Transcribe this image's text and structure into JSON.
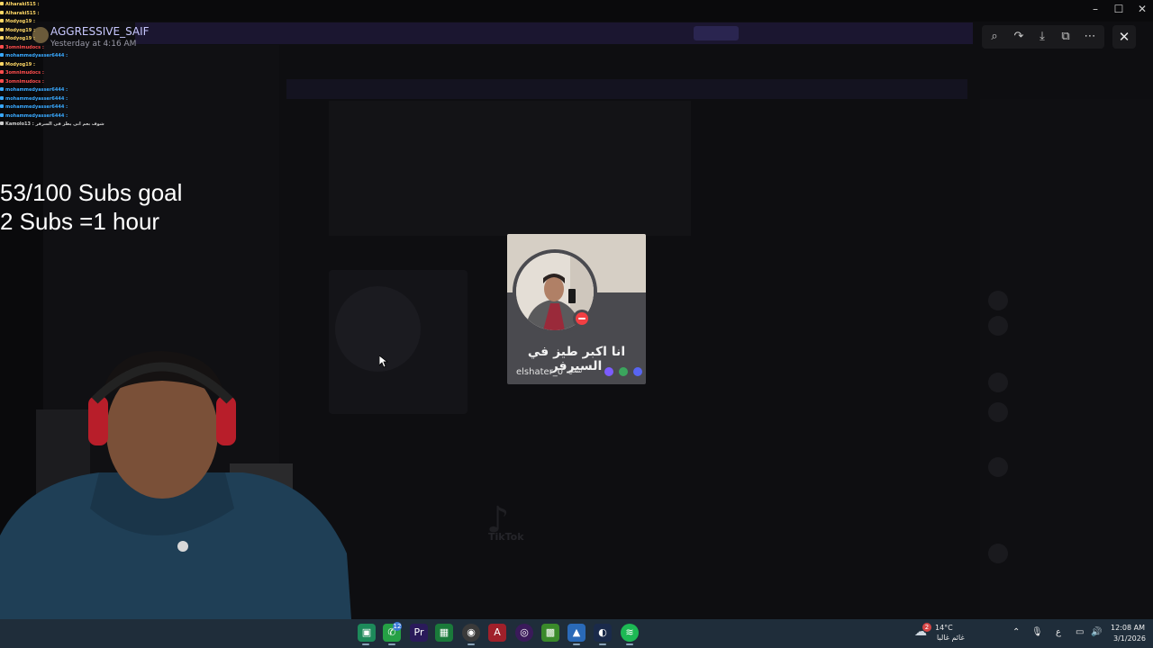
{
  "stream_overlay": {
    "goal_line1": "53/100 Subs goal",
    "goal_line2": "2 Subs =1 hour",
    "chat": [
      {
        "user": "Alharaki515 :",
        "color": "#ffd866"
      },
      {
        "user": "Alharaki515 :",
        "color": "#ffd866"
      },
      {
        "user": "Modyog19 :",
        "color": "#ffd866"
      },
      {
        "user": "Modyog19 :",
        "color": "#ffd866"
      },
      {
        "user": "Modyog19 :",
        "color": "#ffd866"
      },
      {
        "user": "3omnimudocs :",
        "color": "#ff4d4d"
      },
      {
        "user": "mohammedyasser6444 :",
        "color": "#39a9ff"
      },
      {
        "user": "Modyog19 :",
        "color": "#ffd866"
      },
      {
        "user": "3omnimudocs :",
        "color": "#ff4d4d"
      },
      {
        "user": "3omnimudocs :",
        "color": "#ff4d4d"
      },
      {
        "user": "mohammedyasser6444 :",
        "color": "#39a9ff"
      },
      {
        "user": "mohammedyasser6444 :",
        "color": "#39a9ff"
      },
      {
        "user": "mohammedyasser6444 :",
        "color": "#39a9ff"
      },
      {
        "user": "mohammedyasser6444 :",
        "color": "#39a9ff"
      },
      {
        "user": "Kamolo13 : شوف بعم انى يطز فى السرفر",
        "color": "#cfcfcf"
      }
    ]
  },
  "viewer": {
    "author_name": "AGGRESSIVE_SAIF",
    "author_time": "Yesterday at 4:16 AM",
    "toolbar_icons": [
      "zoom-icon",
      "forward-icon",
      "download-icon",
      "open-external-icon",
      "more-icon"
    ],
    "close_icon": "✕"
  },
  "profile_card": {
    "display_name": "انا اكبر طيز في السيرفر",
    "username": "elshater_0",
    "tag": "شغلع",
    "status": "do-not-disturb",
    "badge_colors": [
      "#7c5cff",
      "#3ba55d",
      "#5865f2"
    ]
  },
  "taskbar": {
    "whatsapp_badge": "12",
    "weather_badge": "2",
    "weather_temp": "14°C",
    "weather_desc": "غائم غالبا",
    "lang": "ع",
    "time": "12:08 AM",
    "date": "3/1/2026"
  },
  "background": {
    "tiktok": "TikTok"
  }
}
